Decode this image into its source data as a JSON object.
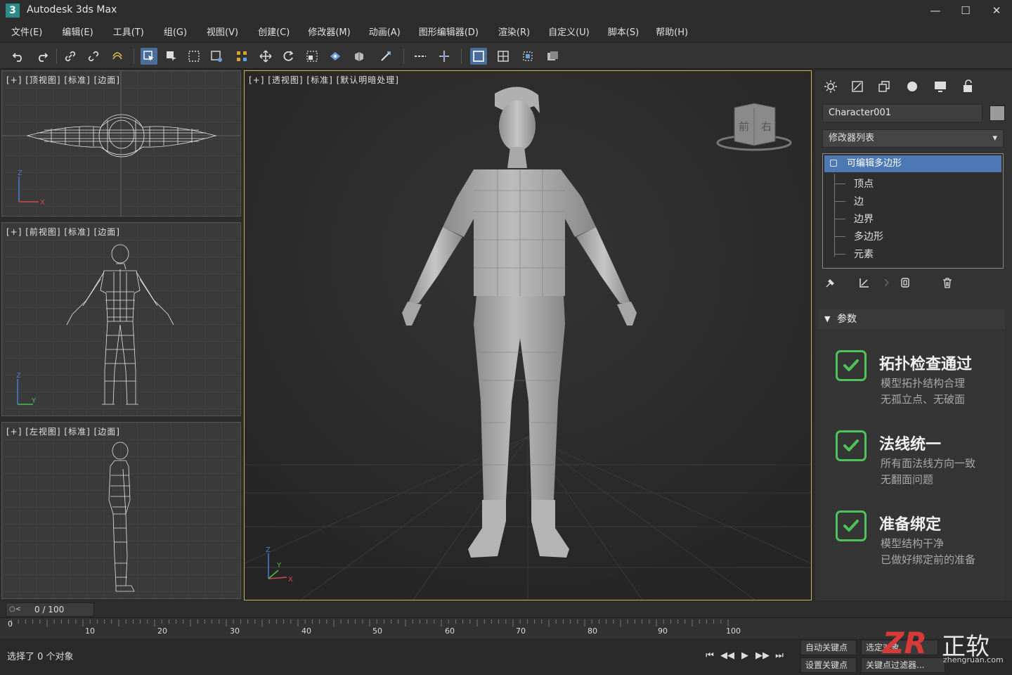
{
  "app": {
    "icon_text": "3",
    "title": "Autodesk 3ds Max",
    "minimize": "—",
    "maximize": "☐",
    "close": "✕"
  },
  "menu": [
    "文件(E)",
    "编辑(E)",
    "工具(T)",
    "组(G)",
    "视图(V)",
    "创建(C)",
    "修改器(M)",
    "动画(A)",
    "图形编辑器(D)",
    "渲染(R)",
    "自定义(U)",
    "脚本(S)",
    "帮助(H)"
  ],
  "viewports": {
    "top": "[+] [顶视图] [标准] [边面]",
    "front": "[+] [前视图] [标准] [边面]",
    "left": "[+] [左视图] [标准] [边面]",
    "perspective": "[+] [透视图] [标准] [默认明暗处理]",
    "viewcube": {
      "front": "前",
      "right": "右"
    },
    "axes": {
      "x": "X",
      "y": "Y",
      "z": "Z"
    }
  },
  "panel": {
    "object_name": "Character001",
    "modifier_list": "修改器列表",
    "stack_selected": "可编辑多边形",
    "sub_objects": [
      "顶点",
      "边",
      "边界",
      "多边形",
      "元素"
    ],
    "rollout_title": "参数",
    "checks": [
      {
        "title": "拓扑检查通过",
        "lines": [
          "模型拓扑结构合理",
          "无孤立点、无破面"
        ]
      },
      {
        "title": "法线统一",
        "lines": [
          "所有面法线方向一致",
          "无翻面问题"
        ]
      },
      {
        "title": "准备绑定",
        "lines": [
          "模型结构干净",
          "已做好绑定前的准备"
        ]
      }
    ],
    "accent_green": "#4fc35a"
  },
  "timeline": {
    "frame_display": "0 / 100",
    "ruler_labels": [
      "0",
      "10",
      "20",
      "30",
      "40",
      "50",
      "60",
      "70",
      "80",
      "90",
      "100"
    ]
  },
  "status": {
    "selection_text": "选择了 0 个对象",
    "auto_key": "自动关键点",
    "set_key": "设置关键点",
    "selected_obj": "选定对象",
    "key_filters": "关键点过滤器..."
  },
  "watermark": {
    "logo": "ZR",
    "text": "正软",
    "url": "zhengruan.com"
  }
}
